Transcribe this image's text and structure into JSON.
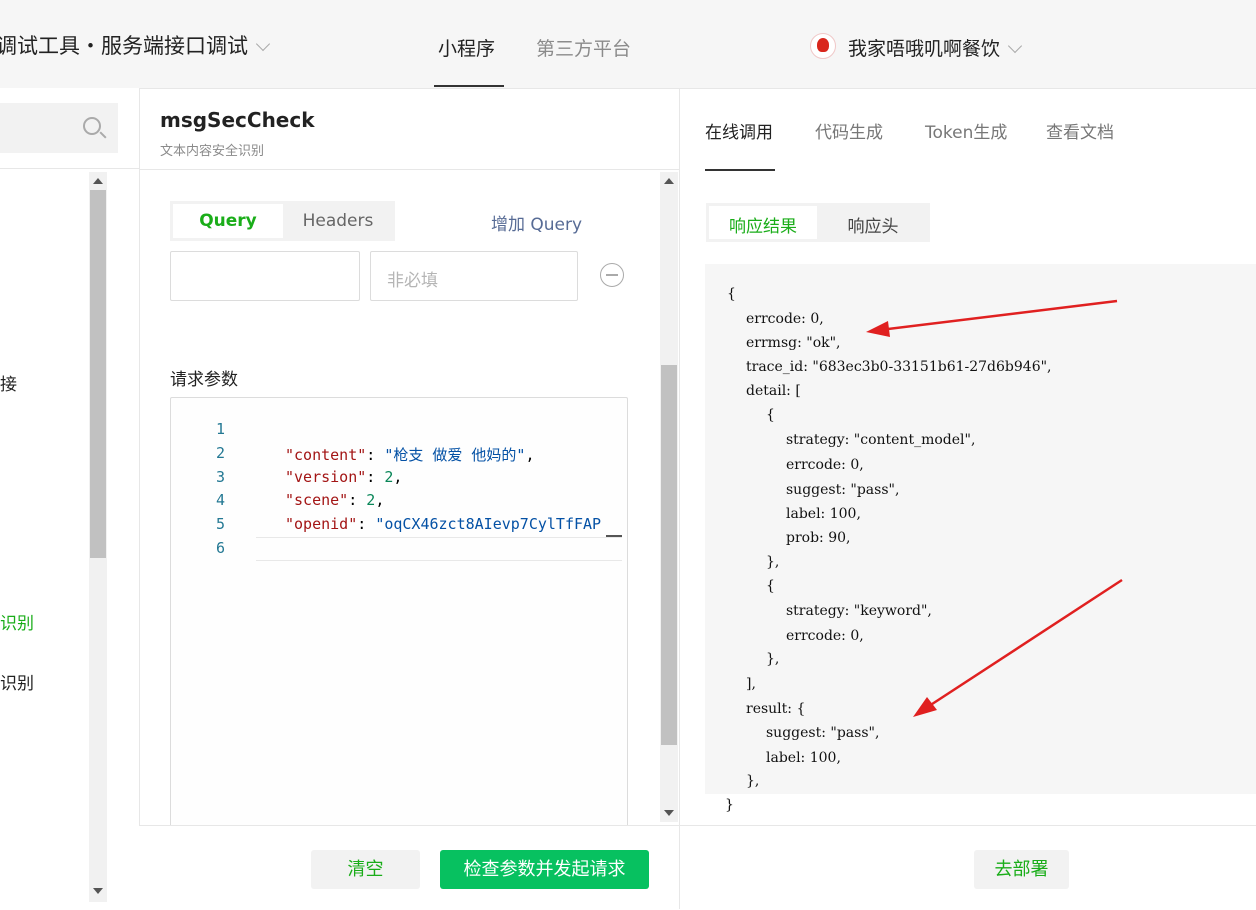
{
  "header": {
    "app_title": "调试工具・服务端接口调试",
    "nav_tabs": [
      "小程序",
      "第三方平台"
    ],
    "account_name": "我家唔哦叽啊餐饮"
  },
  "sidebar": {
    "partial_items": [
      "接",
      "识别",
      "识别"
    ]
  },
  "api": {
    "name": "msgSecCheck",
    "description": "文本内容安全识别"
  },
  "request": {
    "tabs": [
      "Query",
      "Headers"
    ],
    "add_query": "增加 Query",
    "value_placeholder": "非必填",
    "params_label": "请求参数",
    "line_numbers": [
      "1",
      "2",
      "3",
      "4",
      "5",
      "6"
    ],
    "code": {
      "l2_key": "\"content\"",
      "l2_val": "\"枪支 做爱 他妈的\"",
      "l3_key": "\"version\"",
      "l3_val": "2",
      "l4_key": "\"scene\"",
      "l4_val": "2",
      "l5_key": "\"openid\"",
      "l5_val": "\"oqCX46zct8AIevp7CylTfFAP"
    },
    "clear_label": "清空",
    "send_label": "检查参数并发起请求"
  },
  "response_panel": {
    "tabs": [
      "在线调用",
      "代码生成",
      "Token生成",
      "查看文档"
    ],
    "sub_tabs": [
      "响应结果",
      "响应头"
    ],
    "lines": [
      "{",
      "errcode: 0,",
      "errmsg: \"ok\",",
      "trace_id: \"683ec3b0-33151b61-27d6b946\",",
      "detail: [",
      "{",
      "strategy: \"content_model\",",
      "errcode: 0,",
      "suggest: \"pass\",",
      "label: 100,",
      "prob: 90,",
      "},",
      "{",
      "strategy: \"keyword\",",
      "errcode: 0,",
      "},",
      "],",
      "result: {",
      "suggest: \"pass\",",
      "label: 100,",
      "},",
      "}"
    ],
    "deploy_label": "去部署"
  },
  "colors": {
    "accent_green": "#07c160",
    "link_blue": "#576b95",
    "annotation_red": "#e02020"
  }
}
